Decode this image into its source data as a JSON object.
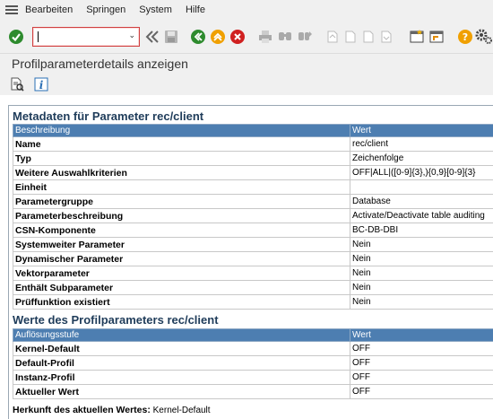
{
  "menu": {
    "items": [
      "Bearbeiten",
      "Springen",
      "System",
      "Hilfe"
    ]
  },
  "toolbar": {
    "command_value": "",
    "icons": [
      "enter-icon",
      "back-double-icon",
      "save-icon",
      "back-icon",
      "exit-icon",
      "cancel-icon",
      "print-icon",
      "find-icon",
      "find-next-icon",
      "first-page-icon",
      "previous-page-icon",
      "next-page-icon",
      "last-page-icon",
      "new-session-icon",
      "shortcut-icon",
      "help-icon",
      "settings-icon"
    ]
  },
  "page": {
    "title": "Profilparameterdetails anzeigen"
  },
  "metadata": {
    "title": "Metadaten für Parameter rec/client",
    "headers": [
      "Beschreibung",
      "Wert"
    ],
    "rows": [
      [
        "Name",
        "rec/client"
      ],
      [
        "Typ",
        "Zeichenfolge"
      ],
      [
        "Weitere Auswahlkriterien",
        "OFF|ALL|([0-9]{3},){0,9}[0-9]{3}"
      ],
      [
        "Einheit",
        ""
      ],
      [
        "Parametergruppe",
        "Database"
      ],
      [
        "Parameterbeschreibung",
        "Activate/Deactivate table auditing"
      ],
      [
        "CSN-Komponente",
        "BC-DB-DBI"
      ],
      [
        "Systemweiter Parameter",
        "Nein"
      ],
      [
        "Dynamischer Parameter",
        "Nein"
      ],
      [
        "Vektorparameter",
        "Nein"
      ],
      [
        "Enthält Subparameter",
        "Nein"
      ],
      [
        "Prüffunktion existiert",
        "Nein"
      ]
    ]
  },
  "values": {
    "title": "Werte des Profilparameters rec/client",
    "headers": [
      "Auflösungsstufe",
      "Wert"
    ],
    "rows": [
      [
        "Kernel-Default",
        "OFF"
      ],
      [
        "Default-Profil",
        "OFF"
      ],
      [
        "Instanz-Profil",
        "OFF"
      ],
      [
        "Aktueller Wert",
        "OFF"
      ]
    ]
  },
  "footer": {
    "label": "Herkunft des aktuellen Wertes:",
    "value": "Kernel-Default"
  }
}
